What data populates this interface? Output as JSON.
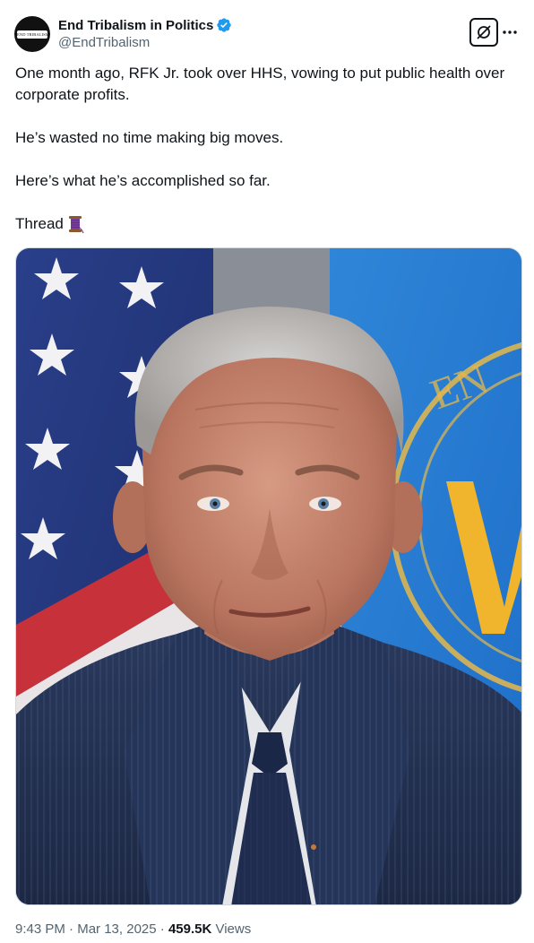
{
  "author": {
    "display_name": "End Tribalism in Politics",
    "handle": "@EndTribalism",
    "avatar_text": "END TRIBALISM",
    "verified_color": "#1d9bf0"
  },
  "actions": {
    "grok_icon": "slashed-circle-icon",
    "more_icon": "more-dots-icon"
  },
  "tweet": {
    "paragraphs": [
      "One month ago, RFK Jr. took over HHS, vowing to put public health over corporate profits.",
      "He’s wasted no time making big moves.",
      "Here’s what he’s accomplished so far."
    ],
    "thread_label": "Thread",
    "thread_emoji": "spool-of-thread-icon"
  },
  "media": {
    "seal_text": "EN"
  },
  "meta": {
    "time": "9:43 PM",
    "separator1": " · ",
    "date": "Mar 13, 2025",
    "separator2": " · ",
    "views_count": "459.5K",
    "views_label": " Views"
  }
}
